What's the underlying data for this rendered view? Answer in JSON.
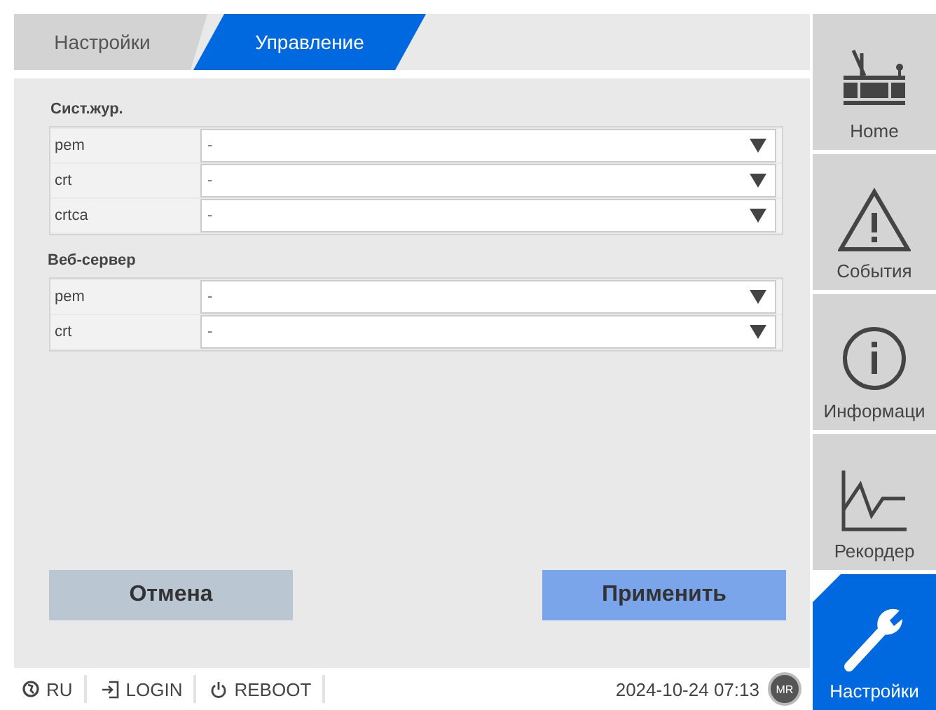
{
  "tabs": [
    {
      "label": "Настройки",
      "selected": false
    },
    {
      "label": "Управление",
      "selected": true
    }
  ],
  "groups": [
    {
      "title": "Сист.жур.",
      "rows": [
        {
          "label": "pem",
          "value": "-"
        },
        {
          "label": "crt",
          "value": "-"
        },
        {
          "label": "crtca",
          "value": "-"
        }
      ]
    },
    {
      "title": "Веб-сервер",
      "rows": [
        {
          "label": "pem",
          "value": "-"
        },
        {
          "label": "crt",
          "value": "-"
        }
      ]
    }
  ],
  "buttons": [
    {
      "label": "Отмена",
      "kind": "cancel"
    },
    {
      "label": "Применить",
      "kind": "apply"
    }
  ],
  "footer": {
    "language": "RU",
    "login": "LOGIN",
    "reboot": "REBOOT",
    "datetime": "2024-10-24 07:13",
    "user": "MR"
  },
  "sidebar": {
    "items": [
      {
        "label": "Home",
        "kind": "home",
        "selected": false
      },
      {
        "label": "События",
        "kind": "events",
        "selected": false
      },
      {
        "label": "Информаци",
        "kind": "info",
        "selected": false
      },
      {
        "label": "Рекордер",
        "kind": "recorder",
        "selected": false
      },
      {
        "label": "Настройки",
        "kind": "settings",
        "selected": true
      }
    ]
  }
}
